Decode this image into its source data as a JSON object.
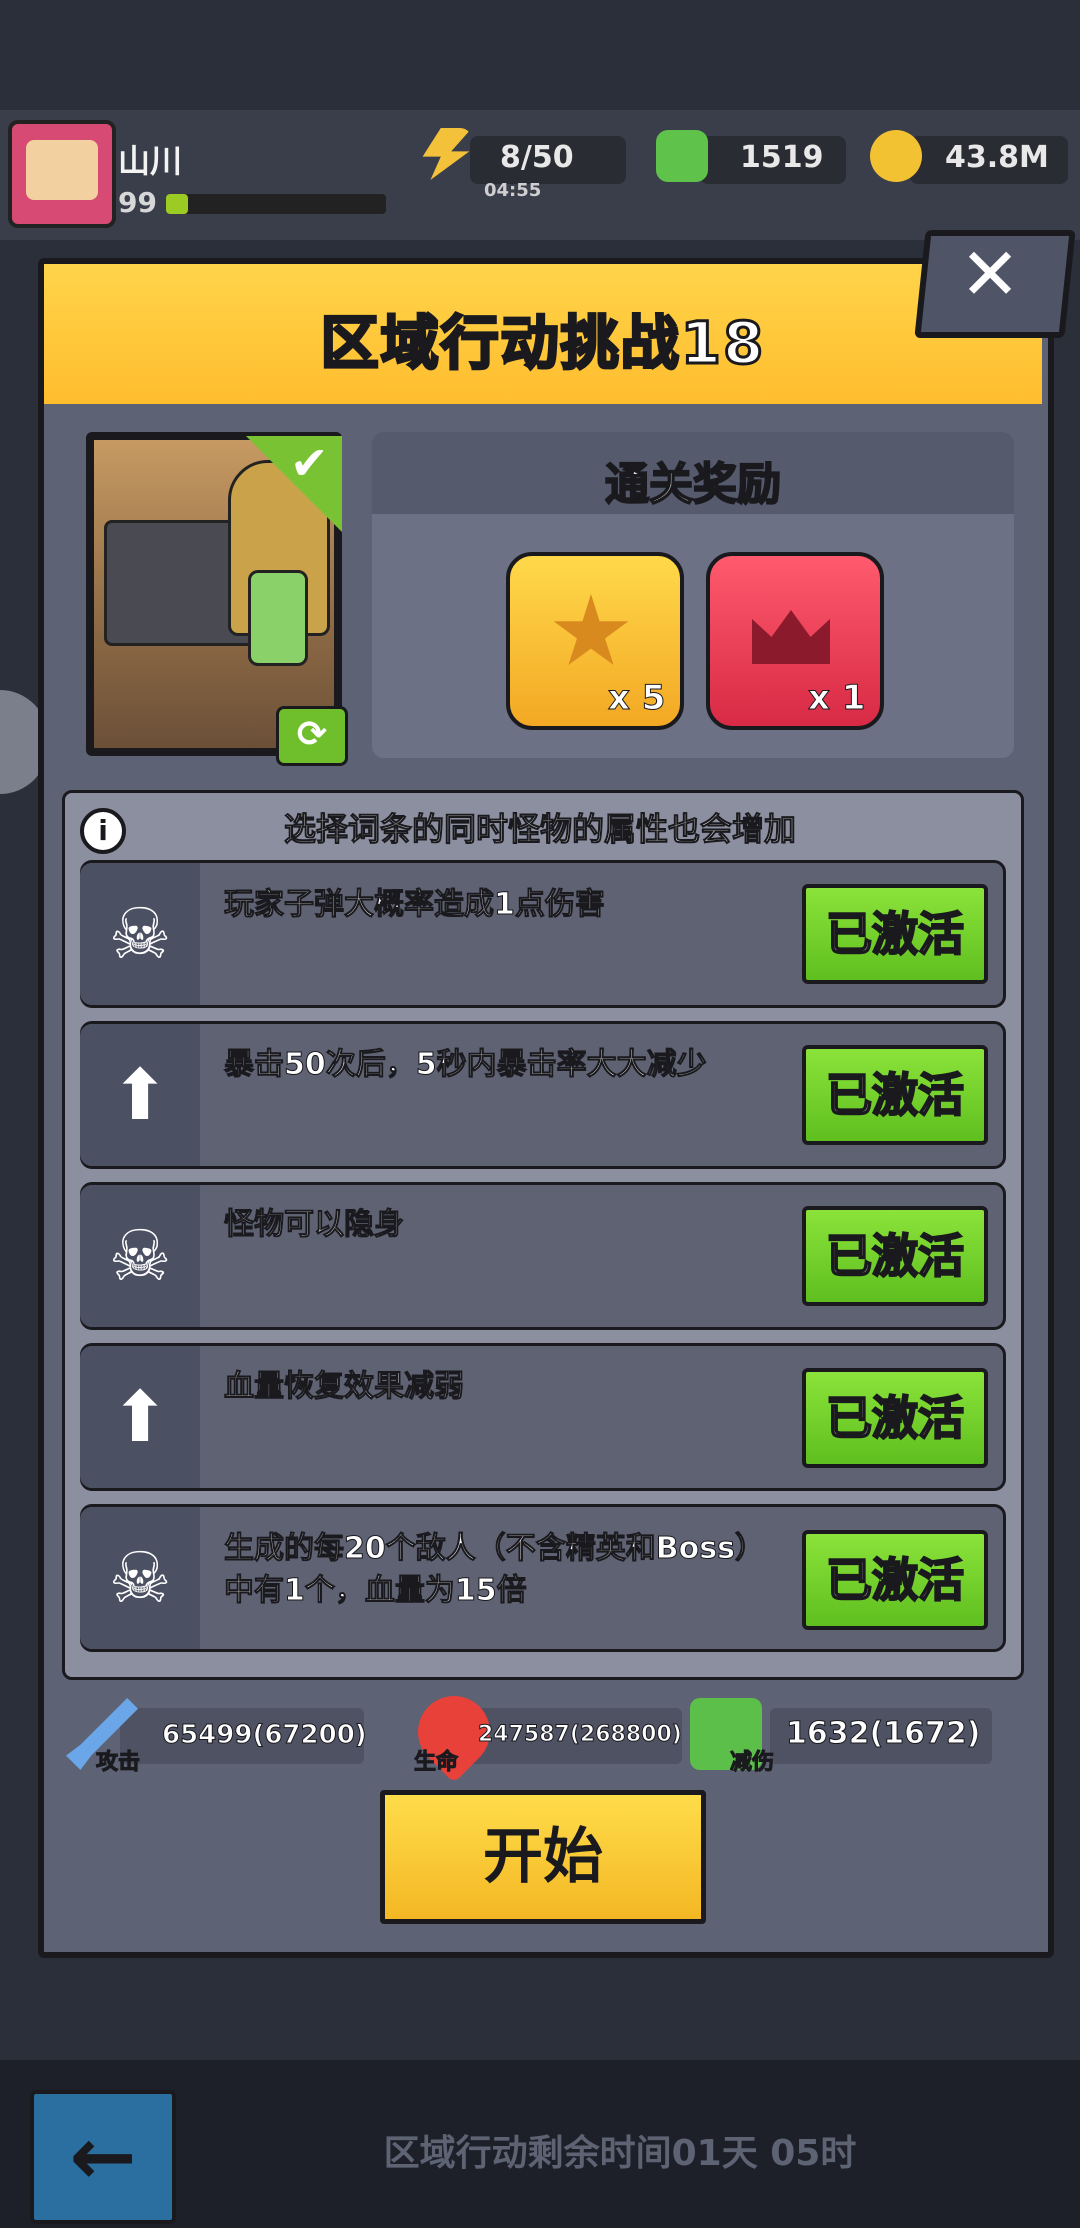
{
  "hud": {
    "player_name": "山川",
    "level": "99",
    "xp_fraction": 0.1,
    "energy": "8/50",
    "energy_timer": "04:55",
    "gems": "1519",
    "coins": "43.8M"
  },
  "modal": {
    "title": "区域行动挑战18",
    "close_label": "✕",
    "refresh_icon": "⟳",
    "check_icon": "✔"
  },
  "rewards": {
    "title": "通关奖励",
    "items": [
      {
        "icon": "star-medal-icon",
        "qty": "x 5"
      },
      {
        "icon": "winged-crown-icon",
        "qty": "x 1"
      }
    ]
  },
  "modifiers": {
    "info_label": "i",
    "hint": "选择词条的同时怪物的属性也会增加",
    "items": [
      {
        "icon": "skull-icon",
        "text": "玩家子弹大概率造成1点伤害",
        "button": "已激活"
      },
      {
        "icon": "up-arrow-icon",
        "text": "暴击50次后，5秒内暴击率大大减少",
        "button": "已激活"
      },
      {
        "icon": "skull-icon",
        "text": "怪物可以隐身",
        "button": "已激活"
      },
      {
        "icon": "up-arrow-icon",
        "text": "血量恢复效果减弱",
        "button": "已激活"
      },
      {
        "icon": "skull-icon",
        "text": "生成的每20个敌人（不含精英和Boss）中有1个，血量为15倍",
        "button": "已激活"
      }
    ]
  },
  "stats": {
    "attack": {
      "label": "攻击",
      "value": "65499(67200)"
    },
    "health": {
      "label": "生命",
      "value": "247587(268800)"
    },
    "defense": {
      "label": "减伤",
      "value": "1632(1672)"
    }
  },
  "start_label": "开始",
  "bottom": {
    "back_icon": "←",
    "remaining_time": "区域行动剩余时间01天 05时"
  },
  "colors": {
    "header_yellow": "#ffc83a",
    "activated_green": "#6fcf25",
    "modal_bg": "#5d6274"
  }
}
